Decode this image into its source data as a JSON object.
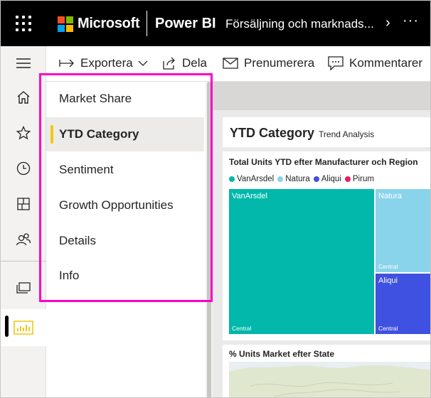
{
  "topbar": {
    "brand": "Microsoft",
    "product": "Power BI",
    "report_title": "Försäljning och marknads...",
    "chevron": "›",
    "more": "···",
    "logo_colors": [
      "#f25022",
      "#7fba00",
      "#00a4ef",
      "#ffb900"
    ]
  },
  "rail": {
    "items": [
      {
        "name": "hamburger-icon"
      },
      {
        "name": "home-icon"
      },
      {
        "name": "favorites-star-icon"
      },
      {
        "name": "recent-clock-icon"
      },
      {
        "name": "apps-icon"
      },
      {
        "name": "shared-people-icon"
      },
      {
        "name": "workspaces-icon"
      },
      {
        "name": "power-bi-report-icon"
      }
    ]
  },
  "toolbar": {
    "export": "Exportera",
    "share": "Dela",
    "subscribe": "Prenumerera",
    "comments": "Kommentarer"
  },
  "pages": {
    "items": [
      {
        "label": "Market Share",
        "active": false
      },
      {
        "label": "YTD Category",
        "active": true
      },
      {
        "label": "Sentiment",
        "active": false
      },
      {
        "label": "Growth Opportunities",
        "active": false
      },
      {
        "label": "Details",
        "active": false
      },
      {
        "label": "Info",
        "active": false
      }
    ],
    "active_marker_color": "#f2c811",
    "highlight_color": "#ff00c8"
  },
  "report": {
    "title": "YTD Category",
    "subtitle": "Trend Analysis",
    "treemap_title": "Total Units YTD efter Manufacturer och Region",
    "legend": [
      {
        "label": "VanArsdel",
        "color": "#01b8aa"
      },
      {
        "label": "Natura",
        "color": "#8ad4eb"
      },
      {
        "label": "Aliqui",
        "color": "#3f51e0"
      },
      {
        "label": "Pirum",
        "color": "#e81e63"
      }
    ],
    "tiles": [
      {
        "name": "VanArsdel",
        "region": "Central"
      },
      {
        "name": "Natura",
        "region": "Central"
      },
      {
        "name": "Aliqui",
        "region": "Central"
      }
    ],
    "map_title": "% Units Market efter State"
  }
}
